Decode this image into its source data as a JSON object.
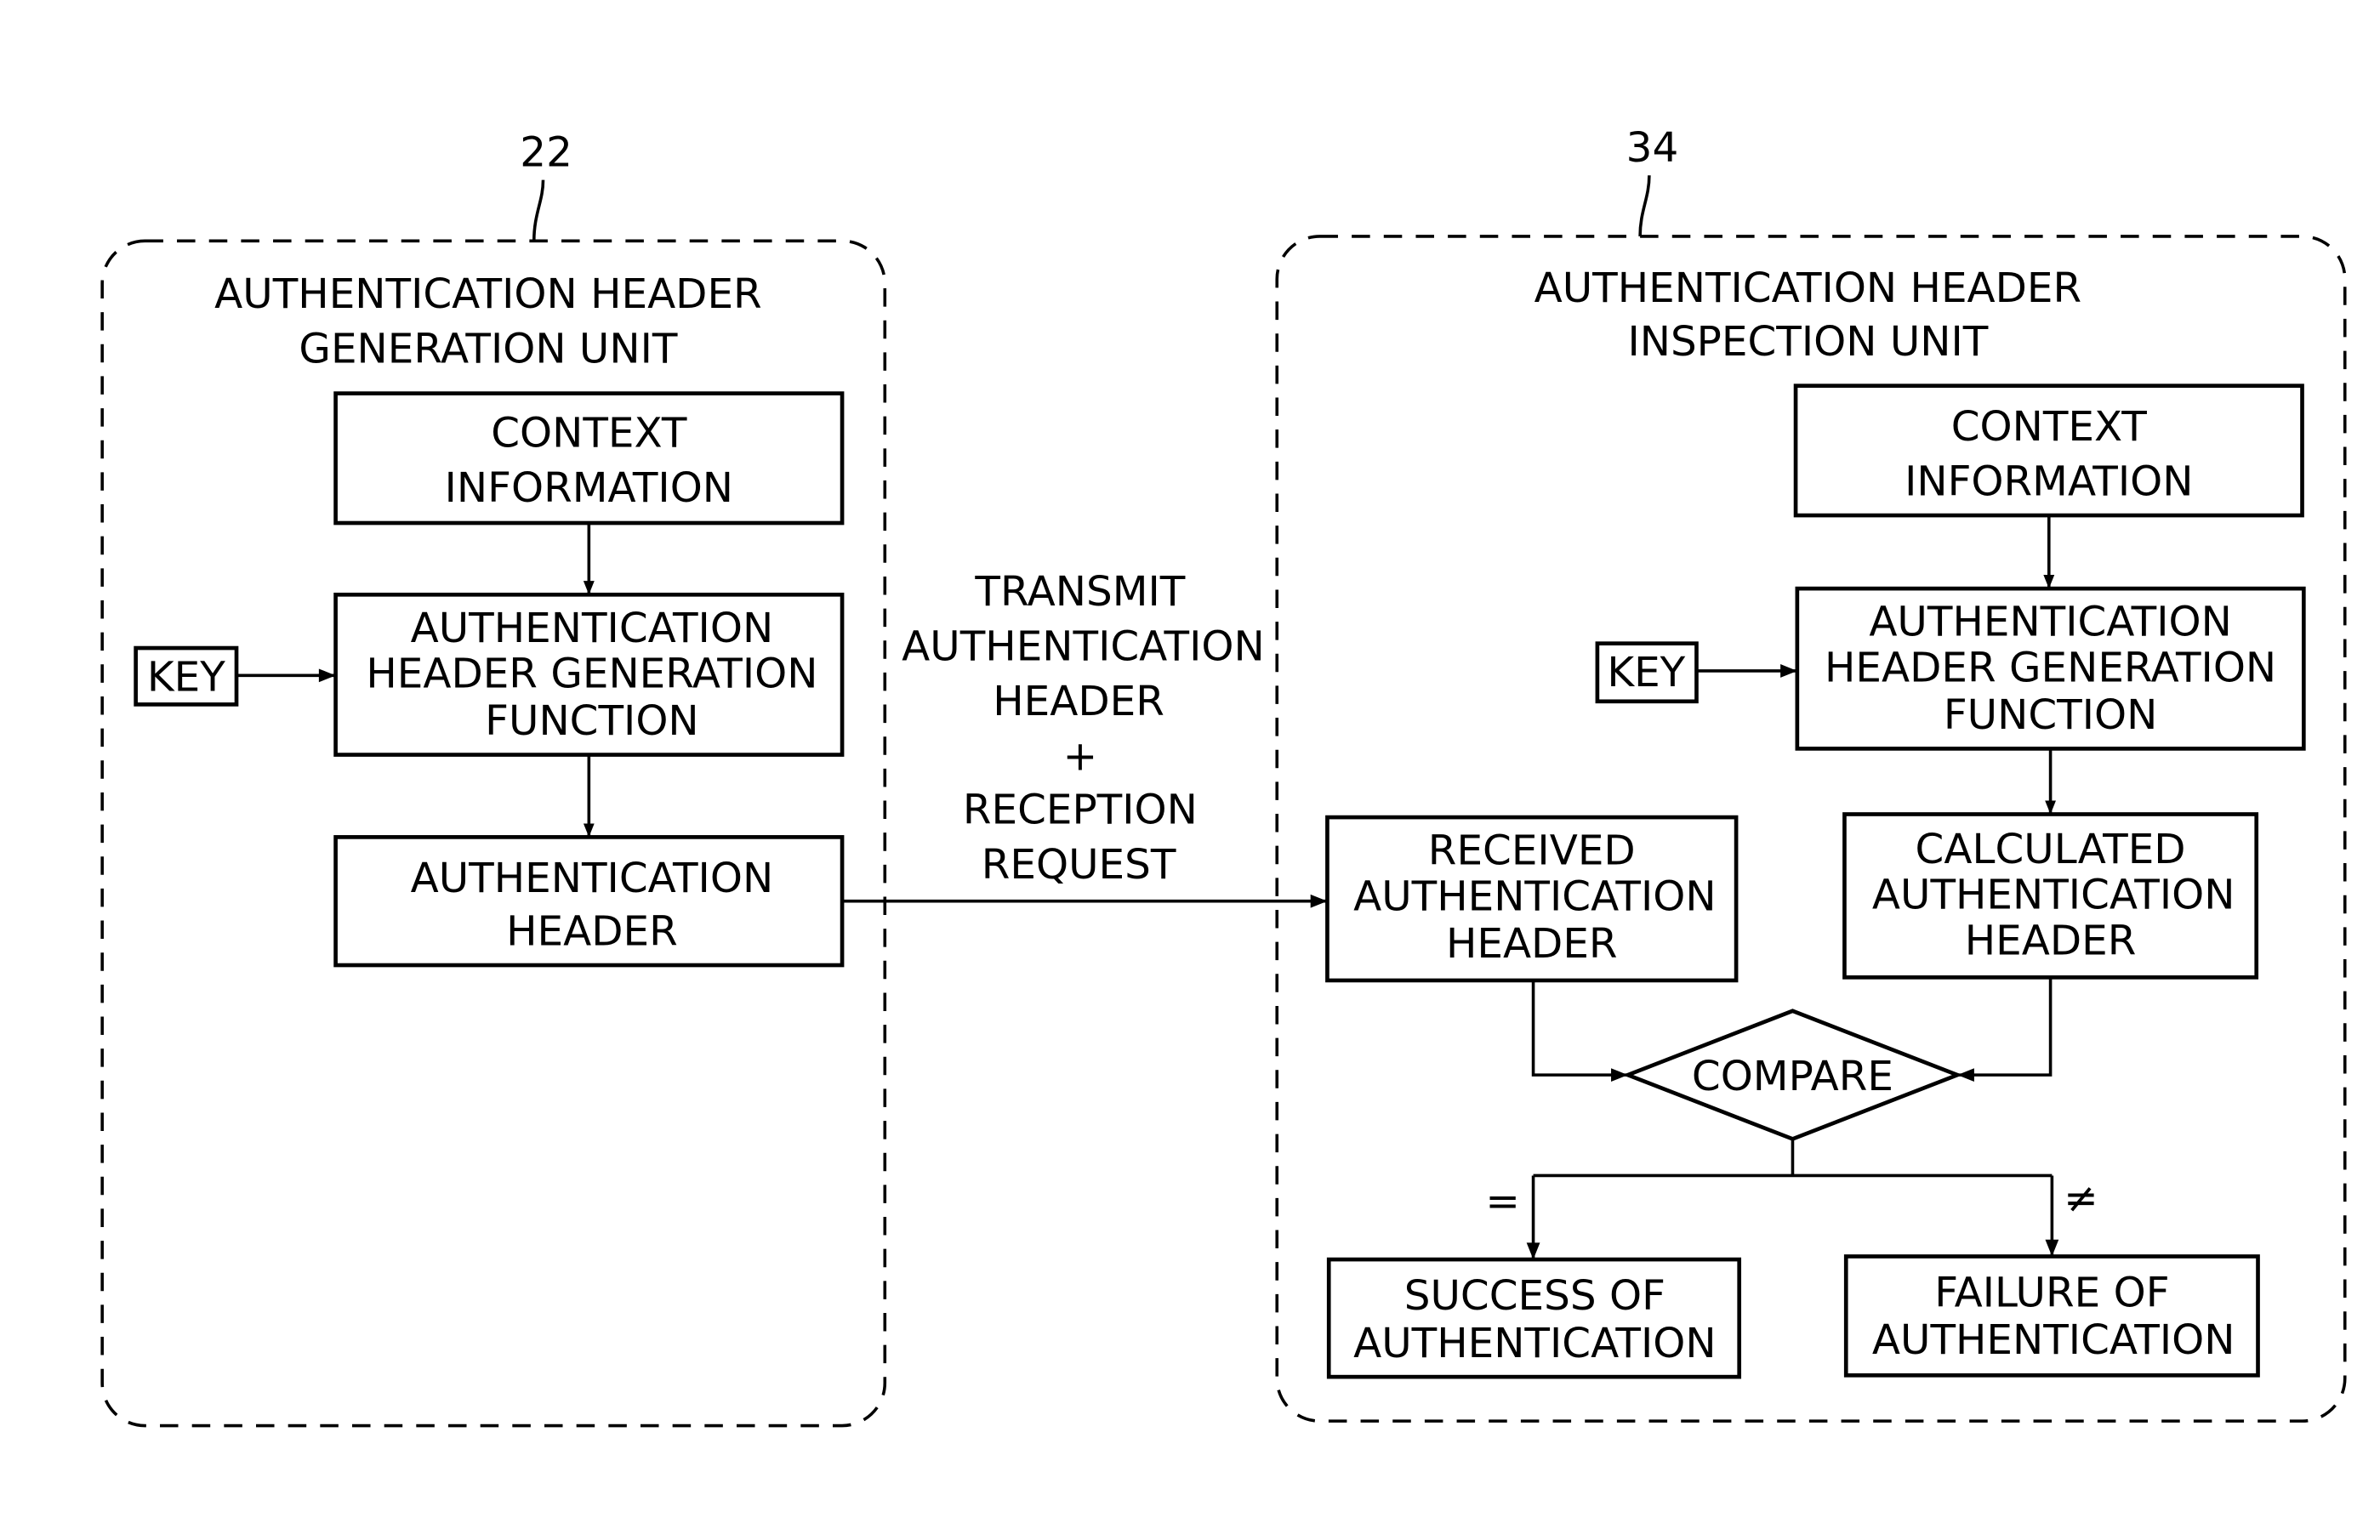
{
  "figure": {
    "generation_unit": {
      "ref_number": "22",
      "title_lines": [
        "AUTHENTICATION HEADER",
        "GENERATION UNIT"
      ],
      "context_box": [
        "CONTEXT",
        "INFORMATION"
      ],
      "key_label": "KEY",
      "function_box": [
        "AUTHENTICATION",
        "HEADER GENERATION",
        "FUNCTION"
      ],
      "header_box": [
        "AUTHENTICATION",
        "HEADER"
      ]
    },
    "transmission": {
      "label_lines": [
        "TRANSMIT",
        "AUTHENTICATION",
        "HEADER",
        "+",
        "RECEPTION",
        "REQUEST"
      ]
    },
    "inspection_unit": {
      "ref_number": "34",
      "title_lines": [
        "AUTHENTICATION HEADER",
        "INSPECTION UNIT"
      ],
      "context_box": [
        "CONTEXT",
        "INFORMATION"
      ],
      "key_label": "KEY",
      "function_box": [
        "AUTHENTICATION",
        "HEADER GENERATION",
        "FUNCTION"
      ],
      "received_box": [
        "RECEIVED",
        "AUTHENTICATION",
        "HEADER"
      ],
      "calculated_box": [
        "CALCULATED",
        "AUTHENTICATION",
        "HEADER"
      ],
      "compare_label": "COMPARE",
      "equal_symbol": "=",
      "not_equal_symbol": "≠",
      "success_box": [
        "SUCCESS OF",
        "AUTHENTICATION"
      ],
      "failure_box": [
        "FAILURE OF",
        "AUTHENTICATION"
      ]
    }
  }
}
